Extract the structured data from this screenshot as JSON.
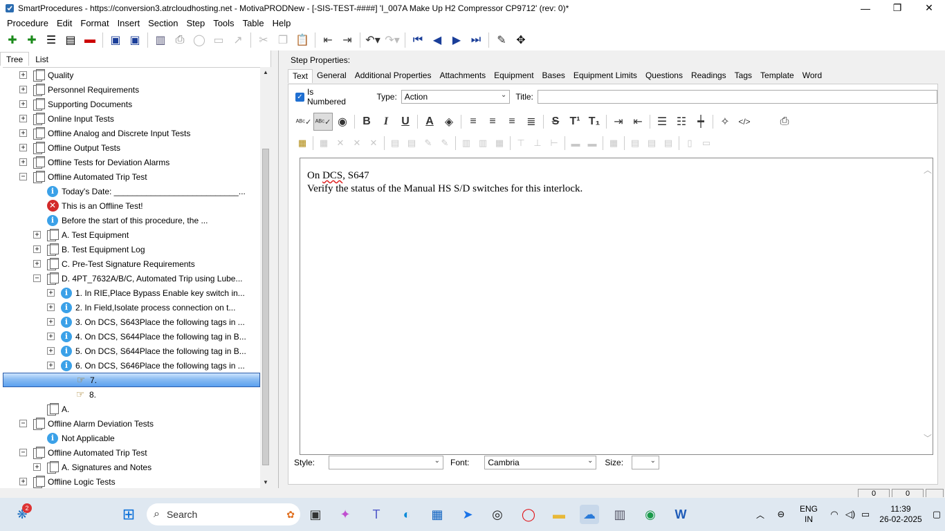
{
  "window": {
    "title": "SmartProcedures - https://conversion3.atrcloudhosting.net - MotivaPRODNew - [-SIS-TEST-####] 'I_007A Make Up H2 Compressor CP9712' (rev: 0)*",
    "minimize": "—",
    "maximize": "❐",
    "close": "✕"
  },
  "menu": [
    {
      "label": "Procedure"
    },
    {
      "label": "Edit"
    },
    {
      "label": "Format"
    },
    {
      "label": "Insert"
    },
    {
      "label": "Section"
    },
    {
      "label": "Step"
    },
    {
      "label": "Tools"
    },
    {
      "label": "Table"
    },
    {
      "label": "Help"
    }
  ],
  "left_tabs": [
    "Tree",
    "List"
  ],
  "tree": [
    {
      "label": "Quality",
      "icon": "document-stack-icon",
      "expander": "+"
    },
    {
      "label": "Personnel Requirements",
      "icon": "document-stack-icon",
      "expander": "+"
    },
    {
      "label": "Supporting Documents",
      "icon": "document-stack-icon",
      "expander": "+"
    },
    {
      "label": "Online Input Tests",
      "icon": "document-stack-icon",
      "expander": "+"
    },
    {
      "label": "Offline Analog and Discrete Input Tests",
      "icon": "document-stack-icon",
      "expander": "+"
    },
    {
      "label": "Offline Output Tests",
      "icon": "document-stack-icon",
      "expander": "+"
    },
    {
      "label": "Offline Tests for Deviation Alarms",
      "icon": "document-stack-icon",
      "expander": "+"
    },
    {
      "label": "Offline Automated Trip Test",
      "icon": "document-stack-icon",
      "expander": "−"
    },
    {
      "label": "Today's Date: ___________________________...",
      "icon": "info-icon",
      "expander": ""
    },
    {
      "label": "This is an Offline Test!",
      "icon": "error-icon",
      "expander": ""
    },
    {
      "label": "Before the start of this procedure, the ...",
      "icon": "info-icon",
      "expander": ""
    },
    {
      "label": "A. Test Equipment",
      "icon": "document-stack-icon",
      "expander": "+"
    },
    {
      "label": "B. Test Equipment Log",
      "icon": "document-stack-icon",
      "expander": "+"
    },
    {
      "label": "C. Pre-Test Signature Requirements",
      "icon": "document-stack-icon",
      "expander": "+"
    },
    {
      "label": "D. 4PT_7632A/B/C, Automated Trip using Lube...",
      "icon": "document-stack-icon",
      "expander": "−"
    },
    {
      "label": "1. In RIE,Place Bypass Enable key switch in...",
      "icon": "info-icon",
      "expander": "+"
    },
    {
      "label": "2. In Field,Isolate process connection on t...",
      "icon": "info-icon",
      "expander": "+"
    },
    {
      "label": "3. On DCS, S643Place the following tags in ...",
      "icon": "info-icon",
      "expander": "+"
    },
    {
      "label": "4. On DCS, S644Place the following tag in B...",
      "icon": "info-icon",
      "expander": "+"
    },
    {
      "label": "5. On DCS, S644Place the following tag in B...",
      "icon": "info-icon",
      "expander": "+"
    },
    {
      "label": "6. On DCS, S646Place the following tags in ...",
      "icon": "info-icon",
      "expander": "+"
    },
    {
      "label": "7.",
      "icon": "pointing-hand-icon",
      "expander": ""
    },
    {
      "label": "8.",
      "icon": "pointing-hand-icon",
      "expander": ""
    },
    {
      "label": "A.",
      "icon": "document-stack-icon",
      "expander": ""
    },
    {
      "label": "Offline Alarm Deviation Tests",
      "icon": "document-stack-icon",
      "expander": "−"
    },
    {
      "label": "Not Applicable",
      "icon": "info-icon",
      "expander": ""
    },
    {
      "label": "Offline Automated Trip Test",
      "icon": "document-stack-icon",
      "expander": "−"
    },
    {
      "label": "A. Signatures and Notes",
      "icon": "document-stack-icon",
      "expander": "+"
    },
    {
      "label": "Offline Logic Tests",
      "icon": "document-stack-icon",
      "expander": "+"
    }
  ],
  "step_properties": {
    "heading": "Step Properties:",
    "tabs": [
      "Text",
      "General",
      "Additional Properties",
      "Attachments",
      "Equipment",
      "Bases",
      "Equipment Limits",
      "Questions",
      "Readings",
      "Tags",
      "Template",
      "Word"
    ],
    "is_numbered_label": "Is Numbered",
    "type_label": "Type:",
    "type_value": "Action",
    "title_label": "Title:",
    "title_value": ""
  },
  "editor": {
    "line1_prefix": "On ",
    "line1_misspelled": "DCS",
    "line1_suffix": ", S647",
    "line2": "Verify the status of the Manual HS S/D switches for this interlock."
  },
  "bottom": {
    "style_label": "Style:",
    "style_value": "",
    "font_label": "Font:",
    "font_value": "Cambria",
    "size_label": "Size:",
    "size_value": ""
  },
  "status": {
    "box1": "0",
    "box2": "0"
  },
  "taskbar": {
    "search_label": "Search",
    "notification_count": "2",
    "lang_line1": "ENG",
    "lang_line2": "IN",
    "time": "11:39",
    "date": "26-02-2025"
  },
  "colors": {
    "selection": "#5aa0ef",
    "info": "#3ba1e8",
    "error": "#d32a2a",
    "toolbar_blue": "#1a3e99"
  }
}
